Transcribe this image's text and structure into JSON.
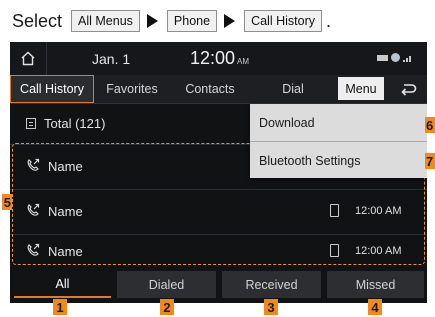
{
  "instruction": {
    "lead": "Select",
    "steps": [
      "All Menus",
      "Phone",
      "Call History"
    ],
    "end": "."
  },
  "status": {
    "date": "Jan.  1",
    "time": "12:00",
    "ampm": "AM"
  },
  "tabs": [
    {
      "label": "Call History"
    },
    {
      "label": "Favorites"
    },
    {
      "label": "Contacts"
    },
    {
      "label": "Dial"
    }
  ],
  "menu_label": "Menu",
  "total_label": "Total (121)",
  "calls": [
    {
      "name": "Name",
      "time": ""
    },
    {
      "name": "Name",
      "time": "12:00 AM"
    },
    {
      "name": "Name",
      "time": "12:00 AM"
    }
  ],
  "dropdown": [
    "Download",
    "Bluetooth Settings"
  ],
  "filters": [
    {
      "label": "All",
      "badge": "1"
    },
    {
      "label": "Dialed",
      "badge": "2"
    },
    {
      "label": "Received",
      "badge": "3"
    },
    {
      "label": "Missed",
      "badge": "4"
    }
  ],
  "side_badges": [
    "5",
    "6",
    "7"
  ],
  "colors": {
    "accent": "#e07a2e",
    "badge": "#f28a1a",
    "screen_bg": "#111214"
  }
}
